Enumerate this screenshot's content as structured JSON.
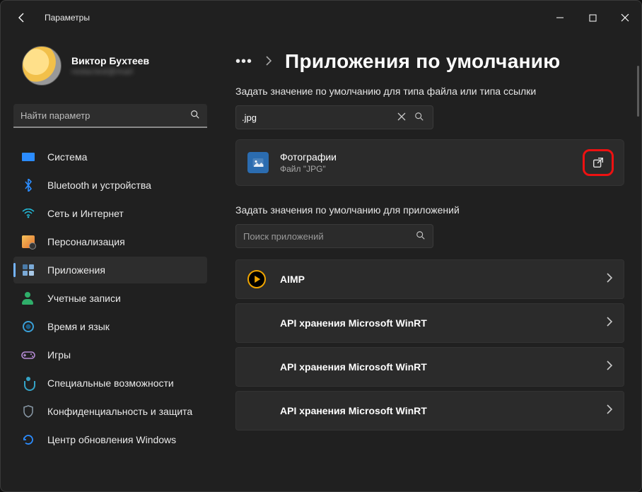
{
  "window": {
    "title": "Параметры"
  },
  "profile": {
    "name": "Виктор Бухтеев",
    "sub": "redacted@mail"
  },
  "sidebar": {
    "search_placeholder": "Найти параметр",
    "items": [
      {
        "label": "Система"
      },
      {
        "label": "Bluetooth и устройства"
      },
      {
        "label": "Сеть и Интернет"
      },
      {
        "label": "Персонализация"
      },
      {
        "label": "Приложения"
      },
      {
        "label": "Учетные записи"
      },
      {
        "label": "Время и язык"
      },
      {
        "label": "Игры"
      },
      {
        "label": "Специальные возможности"
      },
      {
        "label": "Конфиденциальность и защита"
      },
      {
        "label": "Центр обновления Windows"
      }
    ]
  },
  "page": {
    "title": "Приложения по умолчанию",
    "section1_label": "Задать значение по умолчанию для типа файла или типа ссылки",
    "ext_search_value": ".jpg",
    "result": {
      "app": "Фотографии",
      "sub": "Файл \"JPG\""
    },
    "section2_label": "Задать значения по умолчанию для приложений",
    "app_search_placeholder": "Поиск приложений",
    "apps": [
      {
        "label": "AIMP",
        "has_icon": true
      },
      {
        "label": "API хранения Microsoft WinRT",
        "has_icon": false
      },
      {
        "label": "API хранения Microsoft WinRT",
        "has_icon": false
      },
      {
        "label": "API хранения Microsoft WinRT",
        "has_icon": false
      }
    ]
  }
}
